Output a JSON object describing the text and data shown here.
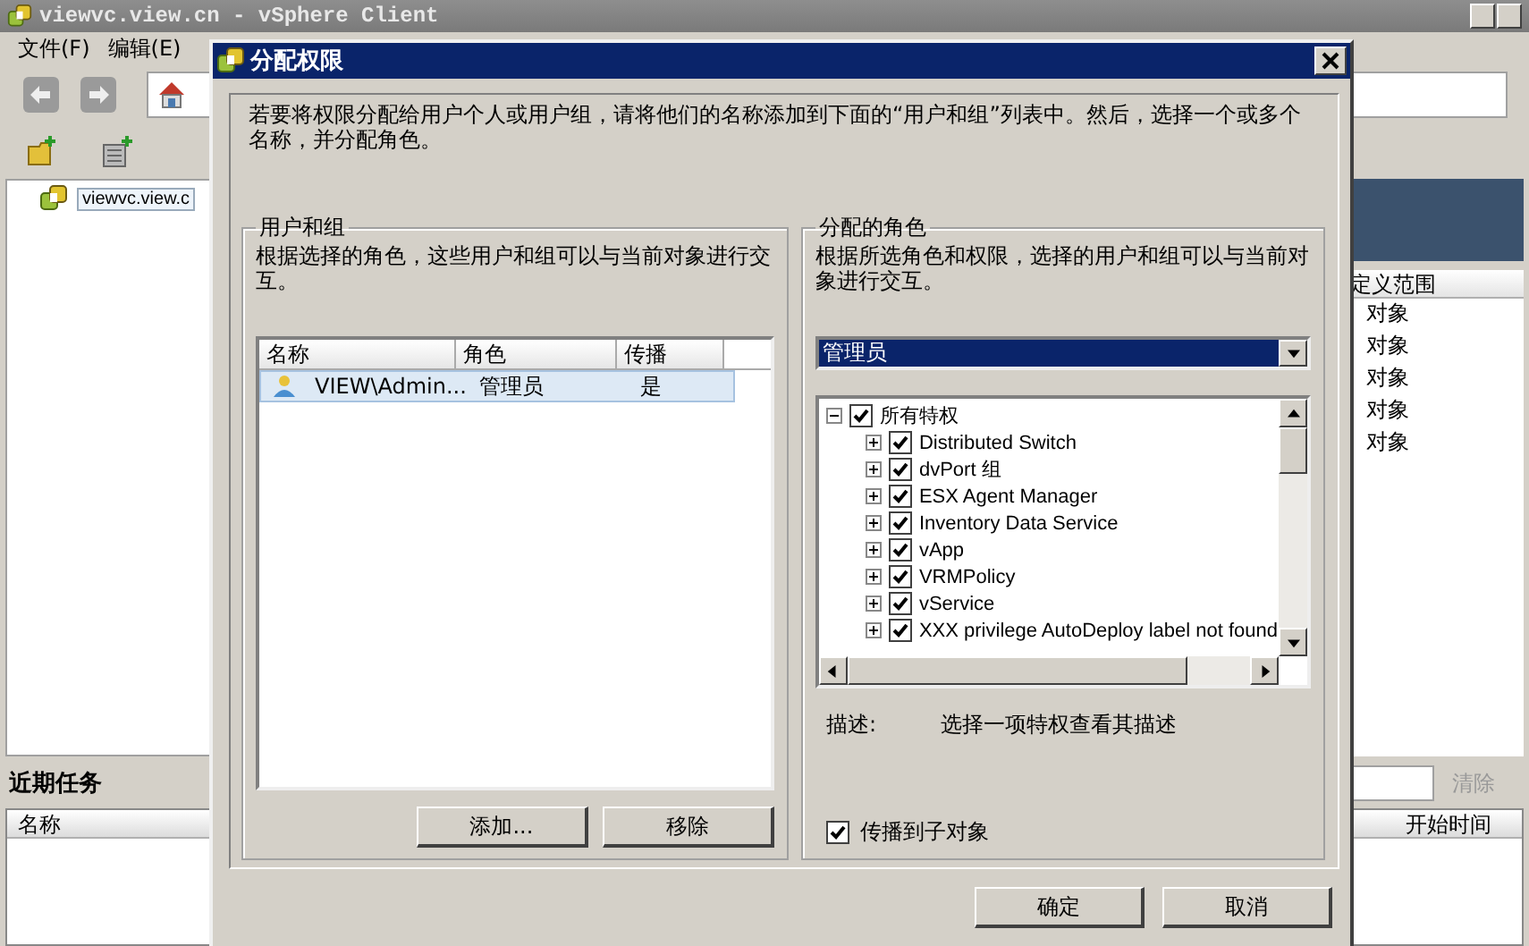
{
  "app": {
    "title": "viewvc.view.cn - vSphere Client",
    "menu": [
      "文件(F)",
      "编辑(E)"
    ],
    "tree": [
      {
        "label": "viewvc.view.c",
        "selected": true
      }
    ],
    "permissions_table": {
      "column_header": "定义范围",
      "rows": [
        "对象",
        "对象",
        "对象",
        "对象",
        "对象"
      ]
    },
    "recent_tasks": {
      "title": "近期任务",
      "clear_button": "清除",
      "columns": [
        "名称",
        "开始时间"
      ]
    }
  },
  "dialog": {
    "title": "分配权限",
    "intro": "若要将权限分配给用户个人或用户组，请将他们的名称添加到下面的“用户和组”列表中。然后，选择一个或多个名称，并分配角色。",
    "users_group": {
      "title": "用户和组",
      "description": "根据选择的角色，这些用户和组可以与当前对象进行交互。",
      "columns": [
        "名称",
        "角色",
        "传播"
      ],
      "rows": [
        {
          "name": "VIEW\\Admin...",
          "role": "管理员",
          "propagate": "是",
          "selected": true
        }
      ],
      "buttons": [
        "添加...",
        "移除"
      ]
    },
    "roles_group": {
      "title": "分配的角色",
      "description": "根据所选角色和权限，选择的用户和组可以与当前对象进行交互。",
      "role": "管理员",
      "privileges": {
        "label": "所有特权",
        "checked": true,
        "expanded": true,
        "children": [
          {
            "label": "Distributed Switch",
            "checked": true,
            "expanded": false
          },
          {
            "label": "dvPort 组",
            "checked": true,
            "expanded": false
          },
          {
            "label": "ESX Agent Manager",
            "checked": true,
            "expanded": false
          },
          {
            "label": "Inventory Data Service",
            "checked": true,
            "expanded": false
          },
          {
            "label": "vApp",
            "checked": true,
            "expanded": false
          },
          {
            "label": "VRMPolicy",
            "checked": true,
            "expanded": false
          },
          {
            "label": "vService",
            "checked": true,
            "expanded": false
          },
          {
            "label": "XXX privilege AutoDeploy label not found",
            "checked": true,
            "expanded": false
          }
        ]
      },
      "description_label": "描述:",
      "description_text": "选择一项特权查看其描述",
      "propagate": {
        "label": "传播到子对象",
        "checked": true
      }
    },
    "footer_buttons": [
      "确定",
      "取消"
    ]
  }
}
